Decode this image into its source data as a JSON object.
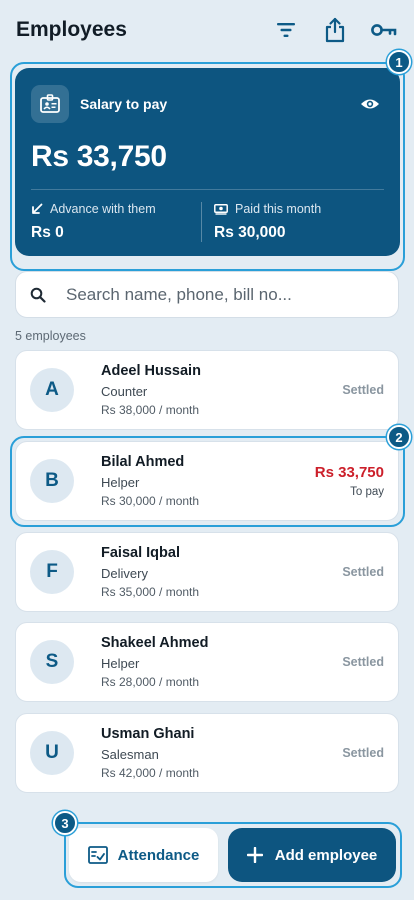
{
  "header": {
    "title": "Employees",
    "icons": [
      "filter-icon",
      "share-icon",
      "key-icon"
    ]
  },
  "salary_card": {
    "label": "Salary to pay",
    "amount": "Rs 33,750",
    "advance_label": "Advance with them",
    "advance_value": "Rs 0",
    "paid_label": "Paid this month",
    "paid_value": "Rs 30,000"
  },
  "search": {
    "placeholder": "Search name, phone, bill no..."
  },
  "employee_count": "5 employees",
  "employees": [
    {
      "initial": "A",
      "name": "Adeel Hussain",
      "role": "Counter",
      "salary": "Rs 38,000 / month",
      "status": "Settled"
    },
    {
      "initial": "B",
      "name": "Bilal Ahmed",
      "role": "Helper",
      "salary": "Rs 30,000 / month",
      "due": "Rs 33,750",
      "due_label": "To pay"
    },
    {
      "initial": "F",
      "name": "Faisal Iqbal",
      "role": "Delivery",
      "salary": "Rs 35,000 / month",
      "status": "Settled"
    },
    {
      "initial": "S",
      "name": "Shakeel Ahmed",
      "role": "Helper",
      "salary": "Rs 28,000 / month",
      "status": "Settled"
    },
    {
      "initial": "U",
      "name": "Usman Ghani",
      "role": "Salesman",
      "salary": "Rs 42,000 / month",
      "status": "Settled"
    }
  ],
  "actions": {
    "attendance": "Attendance",
    "add_employee": "Add employee"
  },
  "markers": [
    "1",
    "2",
    "3"
  ],
  "colors": {
    "primary": "#0d5580",
    "accent_ring": "#2a9fd8",
    "due": "#cc1f2a",
    "background": "#e3ecf3"
  }
}
